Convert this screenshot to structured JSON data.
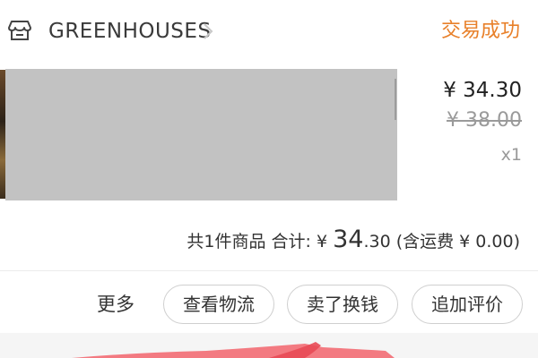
{
  "order": {
    "shop_name": "GREENHOUSES",
    "status": "交易成功",
    "price_current": "¥ 34.30",
    "price_original": "¥ 38.00",
    "quantity": "x1",
    "summary": {
      "count_text": "共1件商品 合计: ¥ ",
      "total_big": "34",
      "total_small": ".30",
      "shipping": " (含运费 ¥ 0.00)"
    }
  },
  "actions": {
    "more": "更多",
    "logistics": "查看物流",
    "resell": "卖了换钱",
    "review": "追加评价"
  },
  "colors": {
    "status": "#e8802a",
    "redacted_block": "#c2c2c2",
    "decor_stroke": "#f2646c"
  },
  "icons": {
    "store": "store-icon",
    "chevron": "chevron-right-icon"
  }
}
